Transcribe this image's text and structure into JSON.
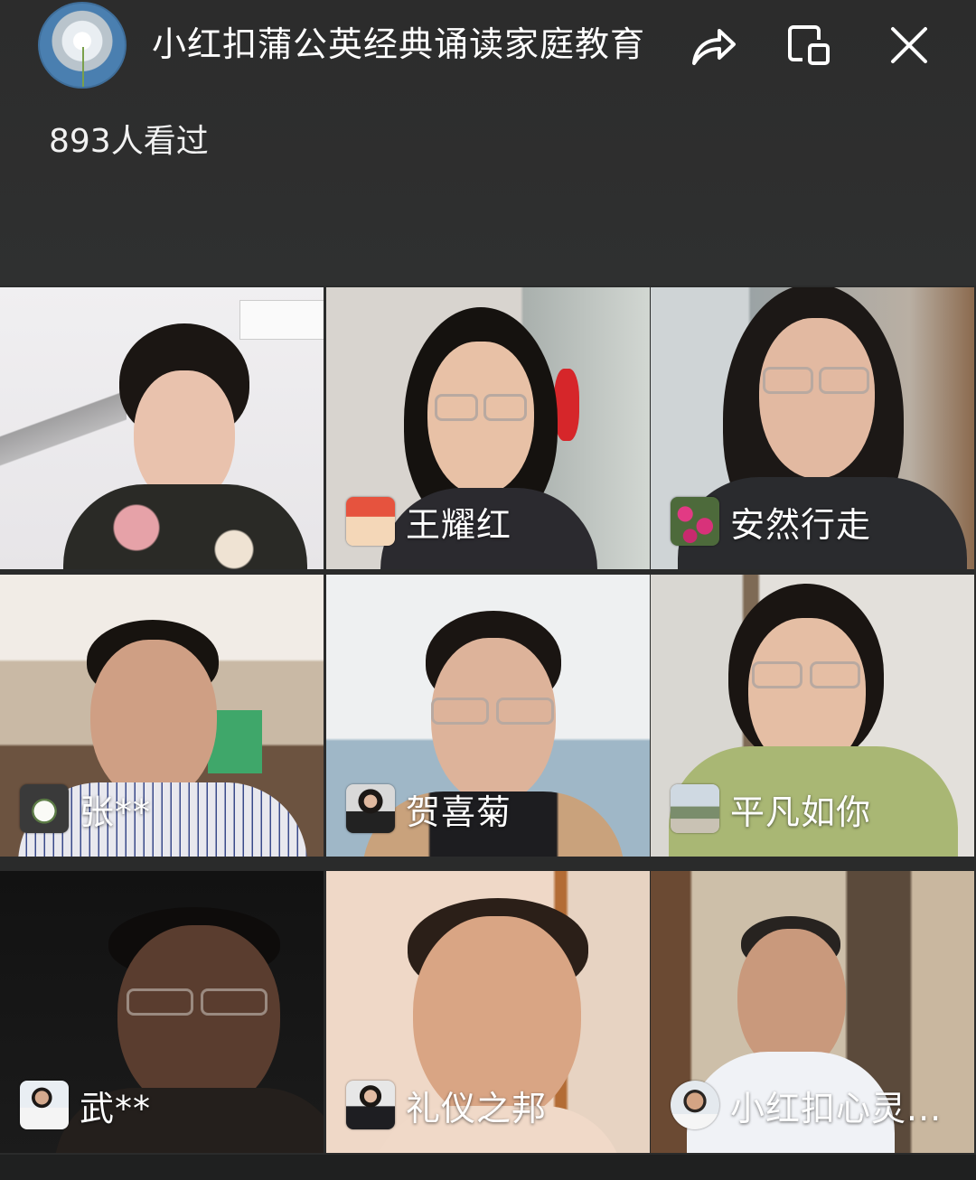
{
  "header": {
    "avatar_icon": "dandelion-avatar",
    "title": "小红扣蒲公英经典诵读家庭教育",
    "share_icon": "share-icon",
    "pip_icon": "picture-in-picture-icon",
    "close_icon": "close-icon",
    "viewers": "893人看过"
  },
  "participants": [
    {
      "name": "",
      "thumb_icon": ""
    },
    {
      "name": "王耀红",
      "thumb_icon": "family-photo-thumb"
    },
    {
      "name": "安然行走",
      "thumb_icon": "pink-flowers-thumb"
    },
    {
      "name": "张**",
      "thumb_icon": "teacup-thumb"
    },
    {
      "name": "贺喜菊",
      "thumb_icon": "portrait-thumb"
    },
    {
      "name": "平凡如你",
      "thumb_icon": "outdoor-photo-thumb"
    },
    {
      "name": "武**",
      "thumb_icon": "man-portrait-thumb"
    },
    {
      "name": "礼仪之邦",
      "thumb_icon": "woman-portrait-thumb"
    },
    {
      "name": "小红扣心灵...",
      "thumb_icon": "man-avatar-thumb"
    }
  ]
}
